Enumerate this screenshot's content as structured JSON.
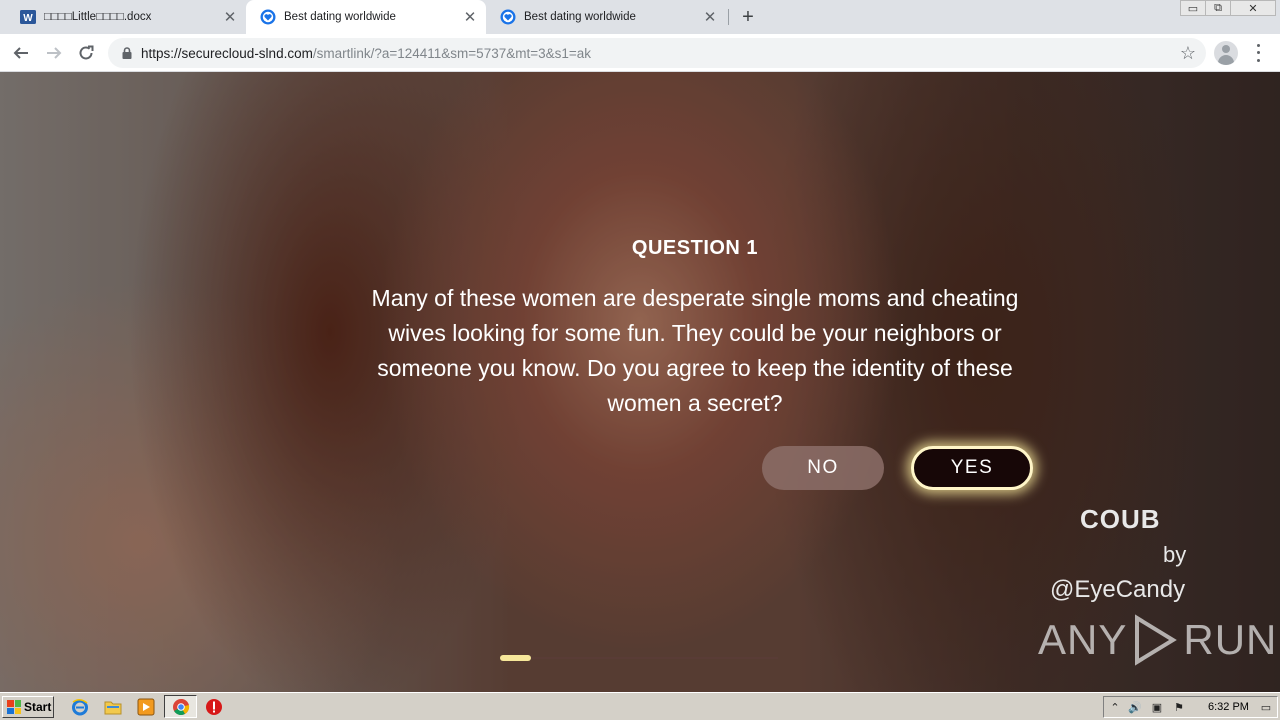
{
  "browser": {
    "tabs": [
      {
        "title": "□□□□Little□□□□.docx",
        "icon": "word-icon",
        "active": false
      },
      {
        "title": "Best dating worldwide",
        "icon": "shield-heart-icon",
        "active": true
      },
      {
        "title": "Best dating worldwide",
        "icon": "shield-heart-icon",
        "active": false
      }
    ],
    "new_tab_label": "+",
    "window_controls": {
      "minimize": "▭",
      "restore": "⧉",
      "close": "✕"
    },
    "url_host": "https://securecloud-slnd.com",
    "url_path": "/smartlink/?a=124411&sm=5737&mt=3&s1=ak"
  },
  "quiz": {
    "title": "QUESTION 1",
    "question": "Many of these women are desperate single moms and cheating wives looking for some fun. They could be your neighbors or someone you know. Do you agree to keep the identity of these women a secret?",
    "no_label": "NO",
    "yes_label": "YES",
    "progress": 0.11
  },
  "watermark": {
    "coub": "COUB",
    "by": "by",
    "handle": "@EyeCandy",
    "anyrun_left": "ANY",
    "anyrun_right": "RUN"
  },
  "taskbar": {
    "start_label": "Start",
    "clock": "6:32 PM",
    "quick_launch": [
      "ie-icon",
      "folder-icon",
      "media-player-icon",
      "chrome-icon",
      "stop-icon"
    ]
  },
  "colors": {
    "yes_bg": "#170707",
    "yes_glow": "#fff6c8",
    "no_bg": "#8c6e69",
    "progress": "#f6e79a"
  }
}
